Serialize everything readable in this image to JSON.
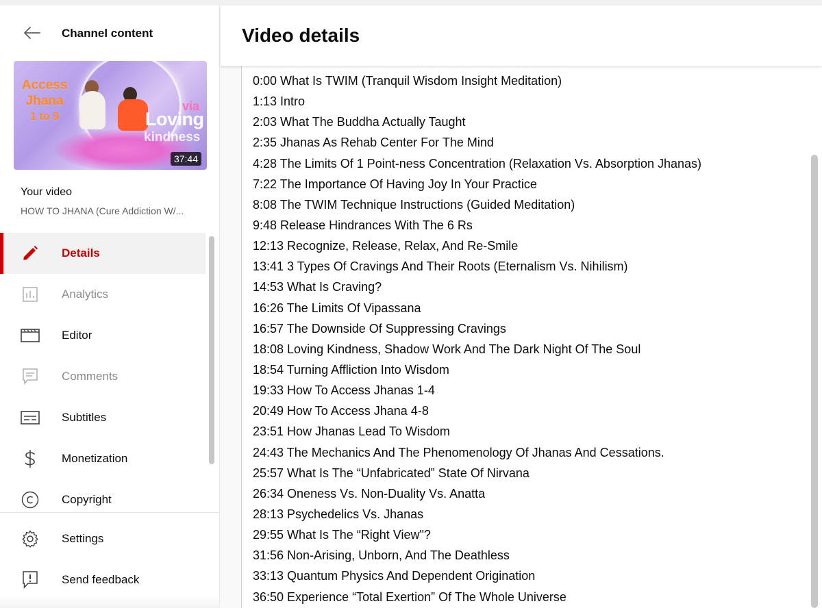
{
  "sidebar": {
    "header_title": "Channel content",
    "thumbnail": {
      "title_line1": "Access",
      "title_line2": "Jhana",
      "title_line3": "1 to 9",
      "via": "via",
      "loving": "Loving",
      "kindness": "kindness",
      "duration": "37:44"
    },
    "your_video_label": "Your video",
    "video_title": "HOW TO JHANA (Cure Addiction W/...",
    "items": [
      {
        "label": "Details",
        "icon": "pencil-icon",
        "active": true
      },
      {
        "label": "Analytics",
        "icon": "analytics-icon",
        "active": false
      },
      {
        "label": "Editor",
        "icon": "editor-film-icon",
        "active": false
      },
      {
        "label": "Comments",
        "icon": "comments-icon",
        "active": false
      },
      {
        "label": "Subtitles",
        "icon": "subtitles-icon",
        "active": false
      },
      {
        "label": "Monetization",
        "icon": "dollar-icon",
        "active": false
      },
      {
        "label": "Copyright",
        "icon": "copyright-icon",
        "active": false
      }
    ],
    "bottom_items": [
      {
        "label": "Settings",
        "icon": "gear-icon"
      },
      {
        "label": "Send feedback",
        "icon": "feedback-icon"
      }
    ]
  },
  "main": {
    "title": "Video details",
    "chapters": [
      "0:00 What Is TWIM (Tranquil Wisdom Insight Meditation)",
      "1:13 Intro",
      "2:03 What The Buddha Actually Taught",
      "2:35 Jhanas As Rehab Center For The Mind",
      "4:28 The Limits Of 1 Point-ness Concentration (Relaxation Vs. Absorption Jhanas)",
      "7:22 The Importance Of Having Joy In Your Practice",
      "8:08 The TWIM Technique Instructions (Guided Meditation)",
      "9:48 Release Hindrances With The 6 Rs",
      "12:13 Recognize, Release, Relax, And Re-Smile",
      "13:41 3 Types Of Cravings And Their Roots (Eternalism Vs. Nihilism)",
      "14:53 What Is Craving?",
      "16:26 The Limits Of Vipassana",
      "16:57 The Downside Of Suppressing Cravings",
      "18:08 Loving Kindness, Shadow Work And The Dark Night Of The Soul",
      "18:54 Turning Affliction Into Wisdom",
      "19:33 How To Access Jhanas 1-4",
      "20:49 How To Access Jhana 4-8",
      "23:51 How Jhanas Lead To Wisdom",
      "24:43 The Mechanics And The Phenomenology Of Jhanas And Cessations.",
      "25:57 What Is The “Unfabricated” State Of Nirvana",
      "26:34 Oneness Vs. Non-Duality Vs. Anatta",
      "28:13 Psychedelics Vs. Jhanas",
      "29:55 What Is The “Right View\"?",
      "31:56 Non-Arising, Unborn, And The Deathless",
      "33:13 Quantum Physics And Dependent Origination",
      "36:50 Experience “Total Exertion” Of The Whole Universe"
    ]
  },
  "colors": {
    "accent": "#cc0000",
    "text": "#0d0d0d",
    "muted": "#606060"
  }
}
